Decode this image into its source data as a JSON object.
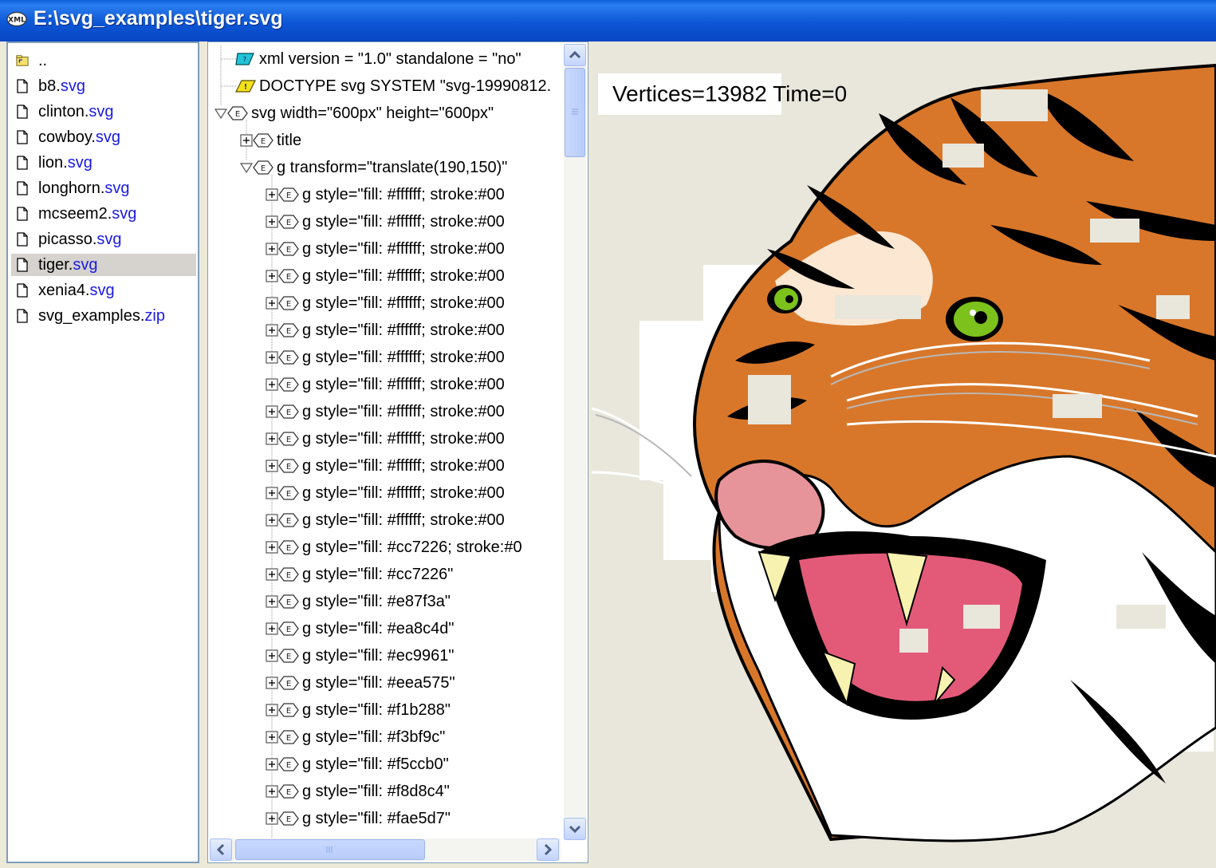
{
  "window": {
    "title": "E:\\svg_examples\\tiger.svg",
    "icon": "xml-icon"
  },
  "files": [
    {
      "name": "..",
      "ext": "",
      "icon": "parent-folder-icon"
    },
    {
      "name": "b8.",
      "ext": "svg",
      "icon": "file-icon"
    },
    {
      "name": "clinton.",
      "ext": "svg",
      "icon": "file-icon"
    },
    {
      "name": "cowboy.",
      "ext": "svg",
      "icon": "file-icon"
    },
    {
      "name": "lion.",
      "ext": "svg",
      "icon": "file-icon"
    },
    {
      "name": "longhorn.",
      "ext": "svg",
      "icon": "file-icon"
    },
    {
      "name": "mcseem2.",
      "ext": "svg",
      "icon": "file-icon"
    },
    {
      "name": "picasso.",
      "ext": "svg",
      "icon": "file-icon"
    },
    {
      "name": "tiger.",
      "ext": "svg",
      "icon": "file-icon",
      "selected": true
    },
    {
      "name": "xenia4.",
      "ext": "svg",
      "icon": "file-icon"
    },
    {
      "name": "svg_examples.",
      "ext": "zip",
      "icon": "file-icon"
    }
  ],
  "tree": [
    {
      "text": "xml version = \"1.0\" standalone = \"no\"",
      "kind": "pi"
    },
    {
      "text": "DOCTYPE svg SYSTEM \"svg-19990812.",
      "kind": "doctype"
    },
    {
      "text": "svg width=\"600px\" height=\"600px\"",
      "kind": "element",
      "expander": "collapse"
    },
    {
      "text": "title",
      "kind": "element",
      "expander": "expand"
    },
    {
      "text": "g transform=\"translate(190,150)\"",
      "kind": "element",
      "expander": "collapse"
    },
    {
      "text": "g style=\"fill: #ffffff; stroke:#00",
      "kind": "element",
      "expander": "expand"
    },
    {
      "text": "g style=\"fill: #ffffff; stroke:#00",
      "kind": "element",
      "expander": "expand"
    },
    {
      "text": "g style=\"fill: #ffffff; stroke:#00",
      "kind": "element",
      "expander": "expand"
    },
    {
      "text": "g style=\"fill: #ffffff; stroke:#00",
      "kind": "element",
      "expander": "expand"
    },
    {
      "text": "g style=\"fill: #ffffff; stroke:#00",
      "kind": "element",
      "expander": "expand"
    },
    {
      "text": "g style=\"fill: #ffffff; stroke:#00",
      "kind": "element",
      "expander": "expand"
    },
    {
      "text": "g style=\"fill: #ffffff; stroke:#00",
      "kind": "element",
      "expander": "expand"
    },
    {
      "text": "g style=\"fill: #ffffff; stroke:#00",
      "kind": "element",
      "expander": "expand"
    },
    {
      "text": "g style=\"fill: #ffffff; stroke:#00",
      "kind": "element",
      "expander": "expand"
    },
    {
      "text": "g style=\"fill: #ffffff; stroke:#00",
      "kind": "element",
      "expander": "expand"
    },
    {
      "text": "g style=\"fill: #ffffff; stroke:#00",
      "kind": "element",
      "expander": "expand"
    },
    {
      "text": "g style=\"fill: #ffffff; stroke:#00",
      "kind": "element",
      "expander": "expand"
    },
    {
      "text": "g style=\"fill: #ffffff; stroke:#00",
      "kind": "element",
      "expander": "expand"
    },
    {
      "text": "g style=\"fill: #cc7226; stroke:#0",
      "kind": "element",
      "expander": "expand"
    },
    {
      "text": "g style=\"fill: #cc7226\"",
      "kind": "element",
      "expander": "expand"
    },
    {
      "text": "g style=\"fill: #e87f3a\"",
      "kind": "element",
      "expander": "expand"
    },
    {
      "text": "g style=\"fill: #ea8c4d\"",
      "kind": "element",
      "expander": "expand"
    },
    {
      "text": "g style=\"fill: #ec9961\"",
      "kind": "element",
      "expander": "expand"
    },
    {
      "text": "g style=\"fill: #eea575\"",
      "kind": "element",
      "expander": "expand"
    },
    {
      "text": "g style=\"fill: #f1b288\"",
      "kind": "element",
      "expander": "expand"
    },
    {
      "text": "g style=\"fill: #f3bf9c\"",
      "kind": "element",
      "expander": "expand"
    },
    {
      "text": "g style=\"fill: #f5ccb0\"",
      "kind": "element",
      "expander": "expand"
    },
    {
      "text": "g style=\"fill: #f8d8c4\"",
      "kind": "element",
      "expander": "expand"
    },
    {
      "text": "g style=\"fill: #fae5d7\"",
      "kind": "element",
      "expander": "expand"
    }
  ],
  "canvas": {
    "stats": "Vertices=13982  Time=0",
    "background": "#e9e6dc",
    "colors": {
      "orange": "#d8772a",
      "black": "#000000",
      "eye": "#7cc11c",
      "mouth": "#e35a78",
      "nose": "#e7939a",
      "teeth": "#f8f2b0"
    }
  }
}
